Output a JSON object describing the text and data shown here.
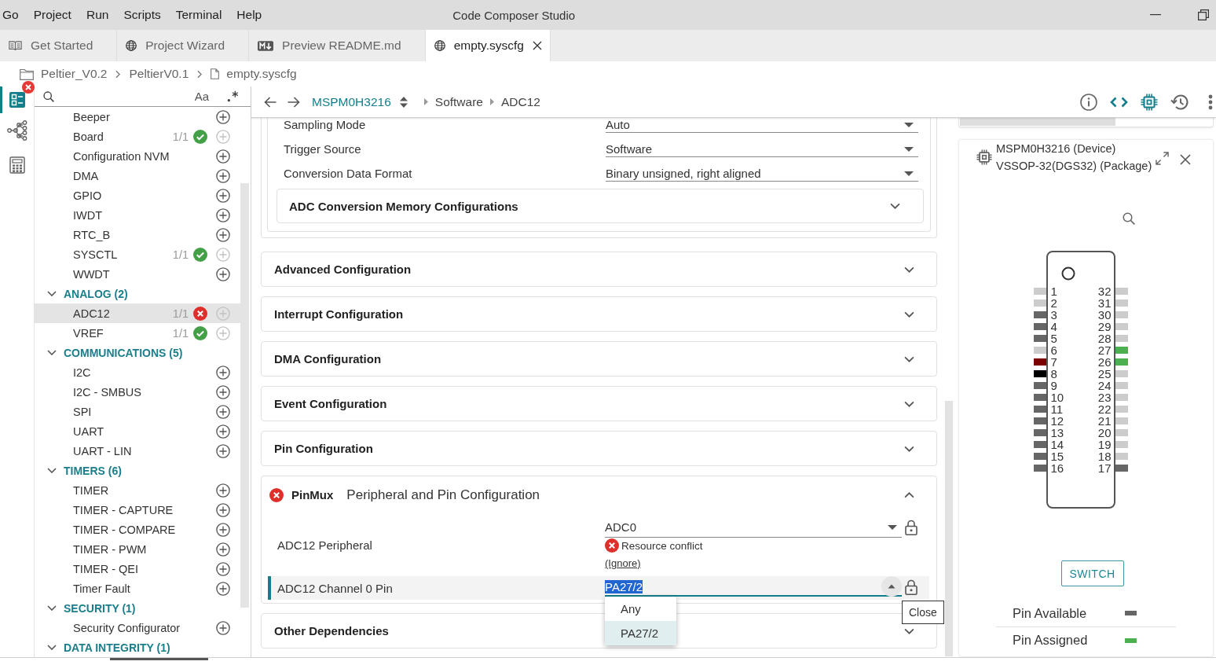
{
  "menu": [
    "Go",
    "Project",
    "Run",
    "Scripts",
    "Terminal",
    "Help"
  ],
  "window": {
    "title": "Code Composer Studio"
  },
  "tabs": [
    {
      "label": "Get Started",
      "kind": "guide",
      "selected": false
    },
    {
      "label": "Project Wizard",
      "kind": "web",
      "selected": false
    },
    {
      "label": "Preview README.md",
      "kind": "markdown",
      "selected": false
    },
    {
      "label": "empty.syscfg",
      "kind": "web",
      "selected": true
    }
  ],
  "path": [
    {
      "label": "Peltier_V0.2",
      "kind": "folder"
    },
    {
      "label": "PeltierV0.1",
      "kind": "plain"
    },
    {
      "label": "empty.syscfg",
      "kind": "file"
    }
  ],
  "activity_bar": [
    {
      "kind": "outline",
      "selected": true,
      "error": true
    },
    {
      "kind": "hierarchy",
      "selected": false,
      "error": false
    },
    {
      "kind": "calculator",
      "selected": false,
      "error": false
    }
  ],
  "sidebar": {
    "match_case": "Aa",
    "tree": [
      {
        "children": [
          {
            "label": "Beeper",
            "selected": false,
            "ok": false,
            "error": false,
            "add_disabled": false
          },
          {
            "label": "Board",
            "selected": false,
            "count": "1/1",
            "ok": true,
            "error": false,
            "add_disabled": true
          },
          {
            "label": "Configuration NVM",
            "selected": false,
            "ok": false,
            "error": false,
            "add_disabled": false
          },
          {
            "label": "DMA",
            "selected": false,
            "ok": false,
            "error": false,
            "add_disabled": false
          },
          {
            "label": "GPIO",
            "selected": false,
            "ok": false,
            "error": false,
            "add_disabled": false
          },
          {
            "label": "IWDT",
            "selected": false,
            "ok": false,
            "error": false,
            "add_disabled": false
          },
          {
            "label": "RTC_B",
            "selected": false,
            "ok": false,
            "error": false,
            "add_disabled": false
          },
          {
            "label": "SYSCTL",
            "selected": false,
            "count": "1/1",
            "ok": true,
            "error": false,
            "add_disabled": true
          },
          {
            "label": "WWDT",
            "selected": false,
            "ok": false,
            "error": false,
            "add_disabled": false
          }
        ]
      },
      {
        "label": "ANALOG (2)",
        "expanded": true,
        "children": [
          {
            "label": "ADC12",
            "selected": true,
            "count": "1/1",
            "ok": false,
            "error": true,
            "add_disabled": true
          },
          {
            "label": "VREF",
            "selected": false,
            "count": "1/1",
            "ok": true,
            "error": false,
            "add_disabled": true
          }
        ]
      },
      {
        "label": "COMMUNICATIONS (5)",
        "expanded": true,
        "children": [
          {
            "label": "I2C",
            "selected": false,
            "ok": false,
            "error": false,
            "add_disabled": false
          },
          {
            "label": "I2C - SMBUS",
            "selected": false,
            "ok": false,
            "error": false,
            "add_disabled": false
          },
          {
            "label": "SPI",
            "selected": false,
            "ok": false,
            "error": false,
            "add_disabled": false
          },
          {
            "label": "UART",
            "selected": false,
            "ok": false,
            "error": false,
            "add_disabled": false
          },
          {
            "label": "UART - LIN",
            "selected": false,
            "ok": false,
            "error": false,
            "add_disabled": false
          }
        ]
      },
      {
        "label": "TIMERS (6)",
        "expanded": true,
        "children": [
          {
            "label": "TIMER",
            "selected": false,
            "ok": false,
            "error": false,
            "add_disabled": false
          },
          {
            "label": "TIMER - CAPTURE",
            "selected": false,
            "ok": false,
            "error": false,
            "add_disabled": false
          },
          {
            "label": "TIMER - COMPARE",
            "selected": false,
            "ok": false,
            "error": false,
            "add_disabled": false
          },
          {
            "label": "TIMER - PWM",
            "selected": false,
            "ok": false,
            "error": false,
            "add_disabled": false
          },
          {
            "label": "TIMER - QEI",
            "selected": false,
            "ok": false,
            "error": false,
            "add_disabled": false
          },
          {
            "label": "Timer Fault",
            "selected": false,
            "ok": false,
            "error": false,
            "add_disabled": false
          }
        ]
      },
      {
        "label": "SECURITY (1)",
        "expanded": true,
        "children": [
          {
            "label": "Security Configurator",
            "selected": false,
            "ok": false,
            "error": false,
            "add_disabled": false
          }
        ]
      },
      {
        "label": "DATA INTEGRITY (1)",
        "expanded": true
      }
    ]
  },
  "toolbar": {
    "device": "MSPM0H3216",
    "crumbs": [
      "Software",
      "ADC12"
    ]
  },
  "basic_settings": [
    {
      "label": "Sampling Mode",
      "value": "Auto"
    },
    {
      "label": "Trigger Source",
      "value": "Software"
    },
    {
      "label": "Conversion Data Format",
      "value": "Binary unsigned, right aligned"
    }
  ],
  "memory_configs": {
    "title": "ADC Conversion Memory Configurations",
    "expanded": false
  },
  "sections": [
    {
      "kind": "collapsible",
      "title": "Advanced Configuration",
      "expanded": false
    },
    {
      "kind": "collapsible",
      "title": "Interrupt Configuration",
      "expanded": false
    },
    {
      "kind": "collapsible",
      "title": "DMA Configuration",
      "expanded": false
    },
    {
      "kind": "collapsible",
      "title": "Event Configuration",
      "expanded": false
    },
    {
      "kind": "collapsible",
      "title": "Pin Configuration",
      "expanded": false
    },
    {
      "kind": "pinmux",
      "title": "PinMux",
      "subtitle": "Peripheral and Pin Configuration",
      "expanded": true,
      "error": true,
      "rows": [
        {
          "label": "ADC12 Peripheral",
          "value": "ADC0",
          "focused": false,
          "open": false,
          "error": "Resource conflict",
          "link": "(Ignore)"
        },
        {
          "label": "ADC12 Channel 0 Pin",
          "value": "PA27/2",
          "focused": true,
          "open": true,
          "tooltip": "Close",
          "options": [
            {
              "label": "Any",
              "selected": false
            },
            {
              "label": "PA27/2",
              "selected": true
            }
          ]
        }
      ]
    },
    {
      "kind": "collapsible",
      "title": "Other Dependencies",
      "expanded": false
    }
  ],
  "device_panel": {
    "device": "MSPM0H3216 (Device)",
    "package": "VSSOP-32(DGS32) (Package)",
    "pins_left": [
      {
        "number": "1",
        "color": "#cccccc"
      },
      {
        "number": "2",
        "color": "#cccccc"
      },
      {
        "number": "3",
        "color": "#666666"
      },
      {
        "number": "4",
        "color": "#666666"
      },
      {
        "number": "5",
        "color": "#666666"
      },
      {
        "number": "6",
        "color": "#cccccc"
      },
      {
        "number": "7",
        "color": "#7b0000"
      },
      {
        "number": "8",
        "color": "#000000"
      },
      {
        "number": "9",
        "color": "#666666"
      },
      {
        "number": "10",
        "color": "#666666"
      },
      {
        "number": "11",
        "color": "#666666"
      },
      {
        "number": "12",
        "color": "#666666"
      },
      {
        "number": "13",
        "color": "#666666"
      },
      {
        "number": "14",
        "color": "#666666"
      },
      {
        "number": "15",
        "color": "#666666"
      },
      {
        "number": "16",
        "color": "#666666"
      }
    ],
    "pins_right": [
      {
        "number": "32",
        "color": "#cccccc"
      },
      {
        "number": "31",
        "color": "#cccccc"
      },
      {
        "number": "30",
        "color": "#cccccc"
      },
      {
        "number": "29",
        "color": "#cccccc"
      },
      {
        "number": "28",
        "color": "#cccccc"
      },
      {
        "number": "27",
        "color": "#4caf50"
      },
      {
        "number": "26",
        "color": "#4caf50"
      },
      {
        "number": "25",
        "color": "#cccccc"
      },
      {
        "number": "24",
        "color": "#cccccc"
      },
      {
        "number": "23",
        "color": "#cccccc"
      },
      {
        "number": "22",
        "color": "#cccccc"
      },
      {
        "number": "21",
        "color": "#cccccc"
      },
      {
        "number": "20",
        "color": "#cccccc"
      },
      {
        "number": "19",
        "color": "#cccccc"
      },
      {
        "number": "18",
        "color": "#cccccc"
      },
      {
        "number": "17",
        "color": "#666666"
      }
    ],
    "button": "SWITCH",
    "legend": [
      {
        "label": "Pin Available",
        "color": "#666666"
      },
      {
        "label": "Pin Assigned",
        "color": "#4caf50"
      }
    ]
  }
}
